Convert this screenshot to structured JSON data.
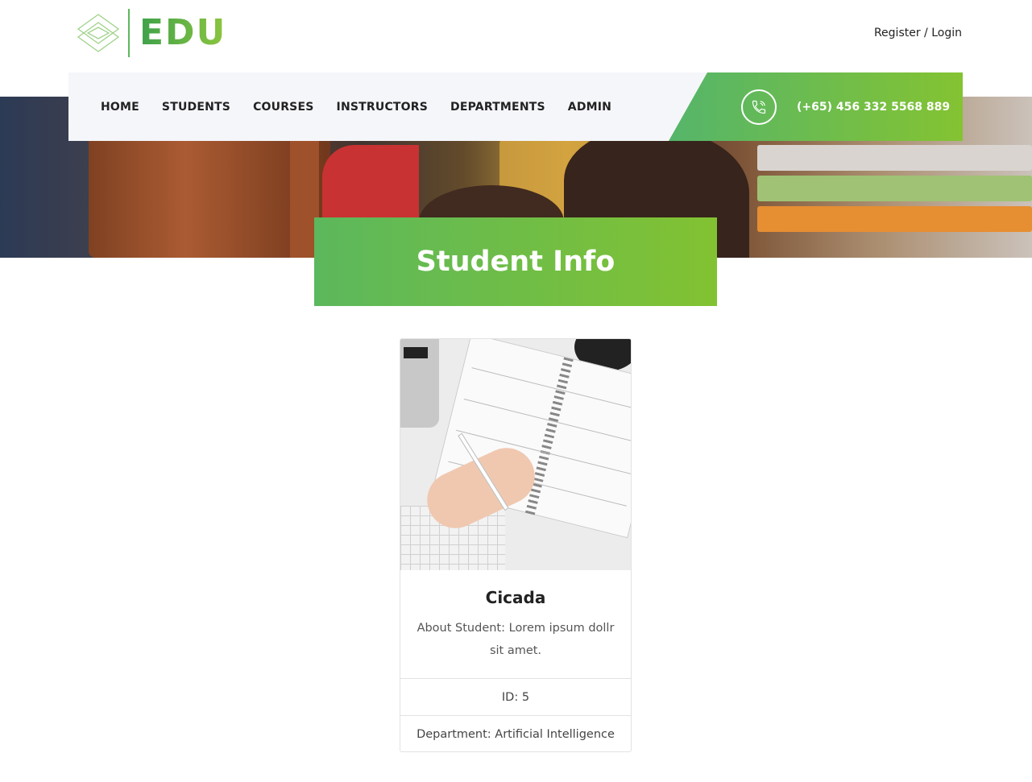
{
  "brand": {
    "name": "EDU"
  },
  "auth": {
    "register": "Register",
    "separator": " / ",
    "login": "Login"
  },
  "nav": {
    "items": [
      {
        "label": "HOME"
      },
      {
        "label": "STUDENTS"
      },
      {
        "label": "COURSES"
      },
      {
        "label": "INSTRUCTORS"
      },
      {
        "label": "DEPARTMENTS"
      },
      {
        "label": "ADMIN"
      }
    ],
    "phone": "(+65) 456 332 5568 889",
    "phone_icon": "phone-icon"
  },
  "page": {
    "title": "Student Info"
  },
  "student": {
    "name": "Cicada",
    "about": "About Student: Lorem ipsum dollr sit amet.",
    "id": "ID: 5",
    "department": "Department: Artificial Intelligence"
  },
  "colors": {
    "accent_start": "#5cb85c",
    "accent_end": "#82c232",
    "nav_bg": "#f5f6fa"
  }
}
